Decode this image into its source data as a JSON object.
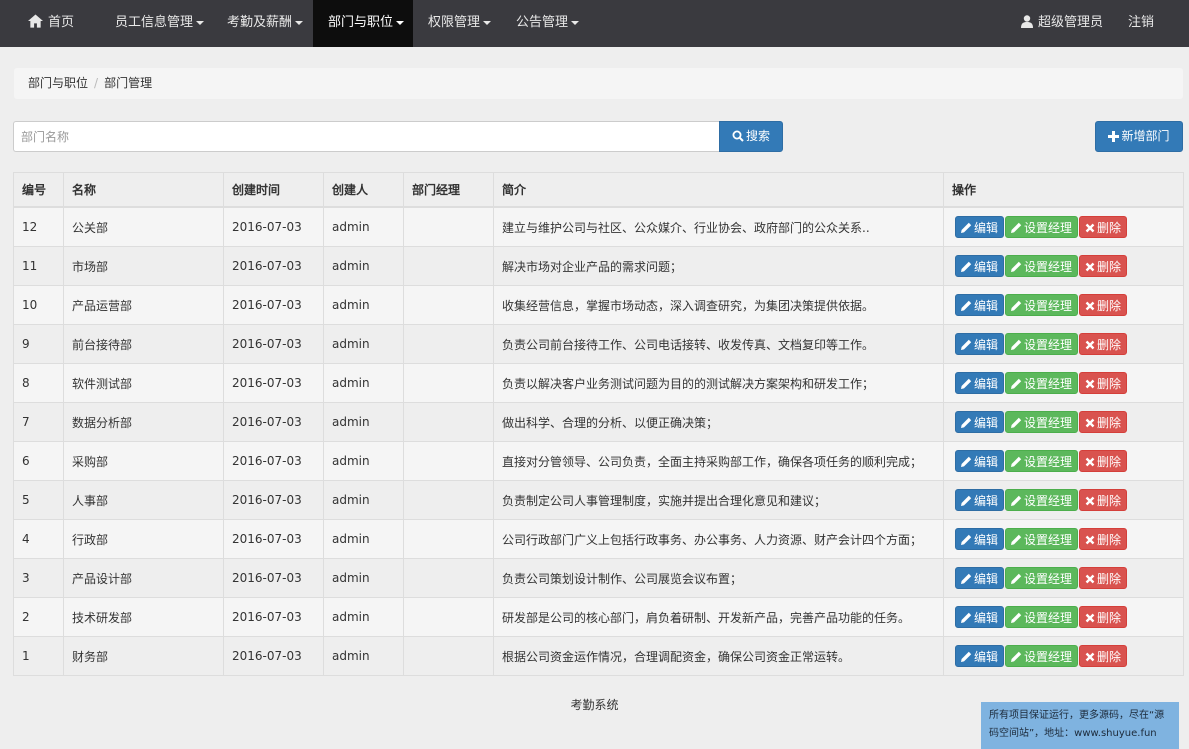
{
  "navbar": {
    "home": "首页",
    "menus": [
      {
        "label": "员工信息管理",
        "active": false
      },
      {
        "label": "考勤及薪酬",
        "active": false
      },
      {
        "label": "部门与职位",
        "active": true
      },
      {
        "label": "权限管理",
        "active": false
      },
      {
        "label": "公告管理",
        "active": false
      }
    ],
    "user": "超级管理员",
    "logout": "注销"
  },
  "breadcrumb": [
    "部门与职位",
    "部门管理"
  ],
  "search": {
    "placeholder": "部门名称",
    "value": "",
    "button_label": "搜索"
  },
  "add_button_label": "新增部门",
  "table": {
    "headers": [
      "编号",
      "名称",
      "创建时间",
      "创建人",
      "部门经理",
      "简介",
      "操作"
    ],
    "rows": [
      {
        "id": "12",
        "name": "公关部",
        "created": "2016-07-03",
        "creator": "admin",
        "manager": "",
        "desc": "建立与维护公司与社区、公众媒介、行业协会、政府部门的公众关系.."
      },
      {
        "id": "11",
        "name": "市场部",
        "created": "2016-07-03",
        "creator": "admin",
        "manager": "",
        "desc": "解决市场对企业产品的需求问题；"
      },
      {
        "id": "10",
        "name": "产品运营部",
        "created": "2016-07-03",
        "creator": "admin",
        "manager": "",
        "desc": "收集经营信息，掌握市场动态，深入调查研究，为集团决策提供依据。"
      },
      {
        "id": "9",
        "name": "前台接待部",
        "created": "2016-07-03",
        "creator": "admin",
        "manager": "",
        "desc": "负责公司前台接待工作、公司电话接转、收发传真、文档复印等工作。"
      },
      {
        "id": "8",
        "name": "软件测试部",
        "created": "2016-07-03",
        "creator": "admin",
        "manager": "",
        "desc": "负责以解决客户业务测试问题为目的的测试解决方案架构和研发工作；"
      },
      {
        "id": "7",
        "name": "数据分析部",
        "created": "2016-07-03",
        "creator": "admin",
        "manager": "",
        "desc": "做出科学、合理的分析、以便正确决策；"
      },
      {
        "id": "6",
        "name": "采购部",
        "created": "2016-07-03",
        "creator": "admin",
        "manager": "",
        "desc": "直接对分管领导、公司负责，全面主持采购部工作，确保各项任务的顺利完成；"
      },
      {
        "id": "5",
        "name": "人事部",
        "created": "2016-07-03",
        "creator": "admin",
        "manager": "",
        "desc": "负责制定公司人事管理制度，实施并提出合理化意见和建议；"
      },
      {
        "id": "4",
        "name": "行政部",
        "created": "2016-07-03",
        "creator": "admin",
        "manager": "",
        "desc": "公司行政部门广义上包括行政事务、办公事务、人力资源、财产会计四个方面；"
      },
      {
        "id": "3",
        "name": "产品设计部",
        "created": "2016-07-03",
        "creator": "admin",
        "manager": "",
        "desc": "负责公司策划设计制作、公司展览会议布置；"
      },
      {
        "id": "2",
        "name": "技术研发部",
        "created": "2016-07-03",
        "creator": "admin",
        "manager": "",
        "desc": "研发部是公司的核心部门，肩负着研制、开发新产品，完善产品功能的任务。"
      },
      {
        "id": "1",
        "name": "财务部",
        "created": "2016-07-03",
        "creator": "admin",
        "manager": "",
        "desc": "根据公司资金运作情况，合理调配资金，确保公司资金正常运转。"
      }
    ],
    "actions": {
      "edit": "编辑",
      "set_manager": "设置经理",
      "delete": "删除"
    }
  },
  "footer": "考勤系统",
  "watermark": "所有项目保证运行，更多源码，尽在“源码空间站”，地址：www.shuyue.fun",
  "colors": {
    "navbar_bg": "#3a3a3f",
    "primary": "#337ab7",
    "success": "#5cb85c",
    "danger": "#d9534f"
  }
}
